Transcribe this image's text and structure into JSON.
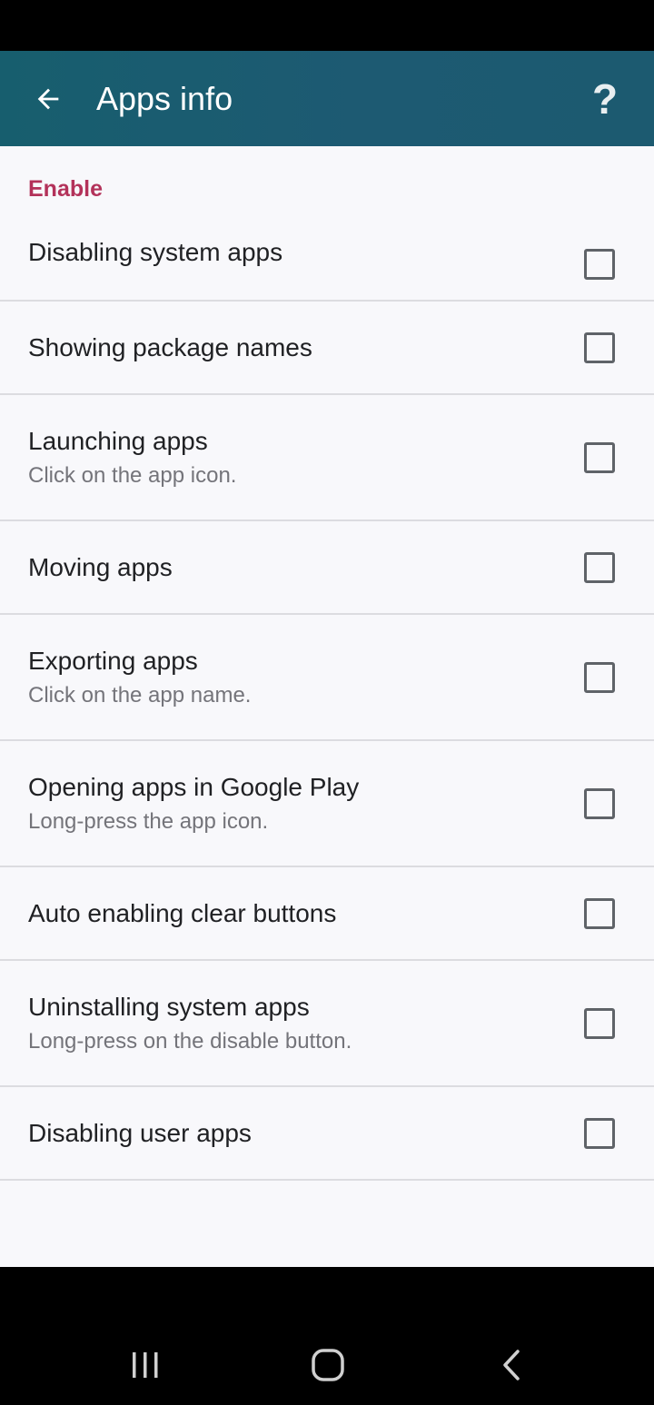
{
  "app_bar": {
    "title": "Apps info",
    "back_icon": "arrow-left-icon",
    "help_label": "?",
    "background": "#1b5c70"
  },
  "section": {
    "header": "Enable",
    "header_color": "#b3325a"
  },
  "preferences": [
    {
      "title": "Disabling system apps",
      "summary": "",
      "checked": false
    },
    {
      "title": "Showing package names",
      "summary": "",
      "checked": false
    },
    {
      "title": "Launching apps",
      "summary": "Click on the app icon.",
      "checked": false
    },
    {
      "title": "Moving apps",
      "summary": "",
      "checked": false
    },
    {
      "title": "Exporting apps",
      "summary": "Click on the app name.",
      "checked": false
    },
    {
      "title": "Opening apps in Google Play",
      "summary": "Long-press the app icon.",
      "checked": false
    },
    {
      "title": "Auto enabling clear buttons",
      "summary": "",
      "checked": false
    },
    {
      "title": "Uninstalling system apps",
      "summary": "Long-press on the disable button.",
      "checked": false
    },
    {
      "title": "Disabling user apps",
      "summary": "",
      "checked": false
    }
  ],
  "nav_bar": {
    "recents_icon": "recents-icon",
    "home_icon": "home-icon",
    "back_icon": "back-chevron-icon"
  }
}
